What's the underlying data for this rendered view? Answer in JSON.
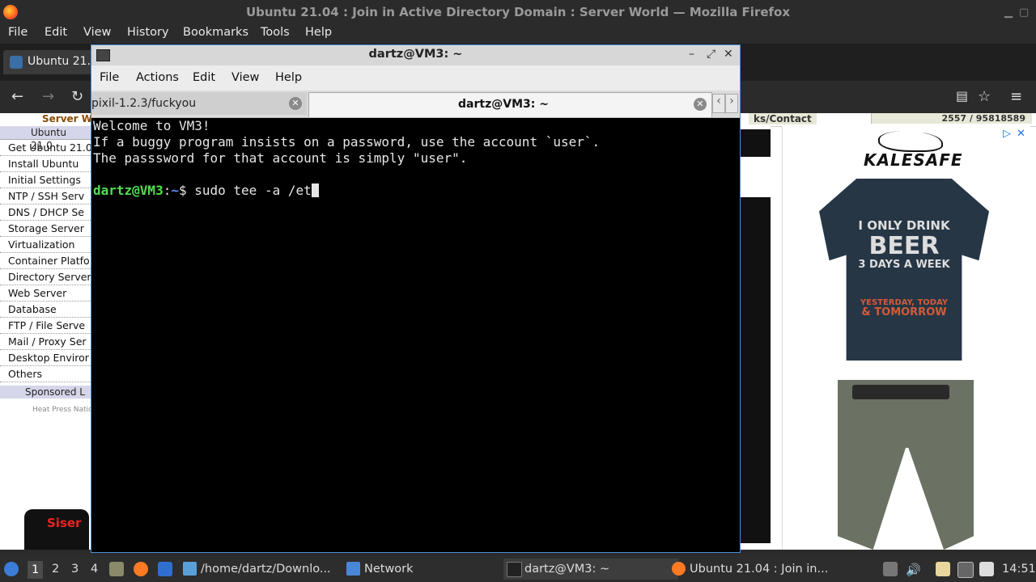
{
  "firefox": {
    "window_title": "Ubuntu 21.04 : Join in Active Directory Domain : Server World — Mozilla Firefox",
    "menu": [
      "File",
      "Edit",
      "View",
      "History",
      "Bookmarks",
      "Tools",
      "Help"
    ],
    "tab_label": "Ubuntu 21.0"
  },
  "web": {
    "site_name": "Server W",
    "links_contact": "ks/Contact",
    "counter": "2557 / 95818589",
    "sidebar_header": "Ubuntu 21.0",
    "sidebar_items": [
      "Get Ubuntu 21.0",
      "Install Ubuntu",
      "Initial Settings",
      "NTP / SSH Serv",
      "DNS / DHCP Se",
      "Storage Server",
      "Virtualization",
      "Container Platfo",
      "Directory Server",
      "Web Server",
      "Database",
      "FTP / File Serve",
      "Mail / Proxy Ser",
      "Desktop Enviror",
      "Others"
    ],
    "sponsored": "Sponsored L",
    "heat_press_text": "Heat Press Natio",
    "siser_logo": "Siser",
    "ad_brand": "KALESAFE",
    "ad_shirt_text": [
      "I ONLY DRINK",
      "BEER",
      "3 DAYS A WEEK",
      "YESTERDAY, TODAY",
      "& TOMORROW"
    ]
  },
  "terminal": {
    "title": "dartz@VM3: ~",
    "menu": [
      "File",
      "Actions",
      "Edit",
      "View",
      "Help"
    ],
    "tabs": [
      "pixil-1.2.3/fuckyou",
      "dartz@VM3: ~"
    ],
    "lines": [
      "Welcome to VM3!",
      "If a buggy program insists on a password, use the account `user`.",
      "The passsword for that account is simply \"user\"."
    ],
    "prompt_user": "dartz@VM3",
    "prompt_sep": ":",
    "prompt_path": "~",
    "prompt_symbol": "$ ",
    "command": "sudo tee -a /et"
  },
  "taskbar": {
    "workspaces": [
      "1",
      "2",
      "3",
      "4"
    ],
    "active_workspace": "1",
    "tasks": [
      "/home/dartz/Downlo...",
      "Network",
      "dartz@VM3: ~",
      "Ubuntu 21.04 : Join in..."
    ],
    "clock": "14:51"
  },
  "colors": {
    "prompt_user": "#4fe04f",
    "prompt_path": "#5c8ff7",
    "terminal_bg": "#000000",
    "window_border": "#4a90d9"
  }
}
